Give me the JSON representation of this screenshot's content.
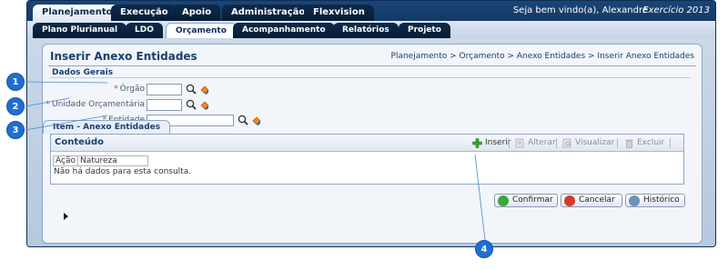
{
  "topnav": {
    "tabs": [
      {
        "label": "Planejamento"
      },
      {
        "label": "Execução"
      },
      {
        "label": "Apoio"
      },
      {
        "label": "Administração"
      },
      {
        "label": "Flexvision"
      }
    ],
    "welcome": "Seja bem vindo(a), Alexandre",
    "exercicio": "Exercício 2013"
  },
  "subnav": {
    "tabs": [
      {
        "label": "Plano Plurianual"
      },
      {
        "label": "LDO"
      },
      {
        "label": "Orçamento"
      },
      {
        "label": "Acompanhamento"
      },
      {
        "label": "Relatórios"
      },
      {
        "label": "Projeto"
      }
    ]
  },
  "page": {
    "title": "Inserir Anexo Entidades",
    "breadcrumb": "Planejamento > Orçamento > Anexo Entidades > Inserir Anexo Entidades"
  },
  "dados_gerais": {
    "title": "Dados Gerais",
    "fields": [
      {
        "label": "Órgão",
        "value": ""
      },
      {
        "label": "Unidade Orçamentária",
        "value": ""
      },
      {
        "label": "Entidade",
        "value": ""
      }
    ],
    "required_mark": "*"
  },
  "item": {
    "tab_label": "Item - Anexo Entidades",
    "title": "Conteúdo",
    "toolbar": [
      {
        "label": "Inserir",
        "icon": "add-icon",
        "enabled": true
      },
      {
        "label": "Alterar",
        "icon": "edit-icon",
        "enabled": false
      },
      {
        "label": "Visualizar",
        "icon": "view-icon",
        "enabled": false
      },
      {
        "label": "Excluir",
        "icon": "trash-icon",
        "enabled": false
      }
    ],
    "columns": [
      "Ação",
      "Natureza"
    ],
    "empty_message": "Não há dados para esta consulta."
  },
  "actions": [
    {
      "label": "Confirmar",
      "icon": "check-icon"
    },
    {
      "label": "Cancelar",
      "icon": "cancel-icon"
    },
    {
      "label": "Histórico",
      "icon": "history-icon"
    }
  ],
  "callouts": [
    "1",
    "2",
    "3",
    "4"
  ],
  "colors": {
    "header_blue": "#1b4a7e",
    "callout_blue": "#1e6fd0",
    "title_blue": "#1a3f6f"
  }
}
